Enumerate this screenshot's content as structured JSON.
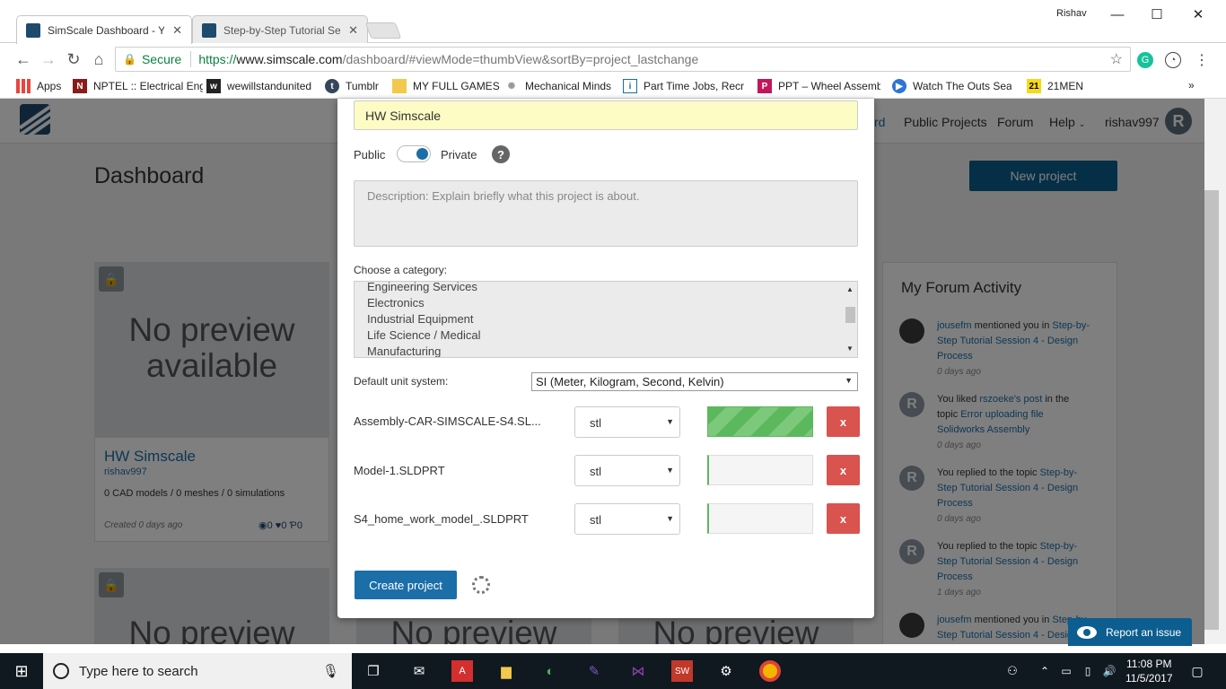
{
  "browser": {
    "tabs": [
      {
        "title": "SimScale Dashboard - Yo",
        "active": true
      },
      {
        "title": "Step-by-Step Tutorial Se",
        "active": false
      }
    ],
    "user": "Rishav",
    "url": {
      "secure_label": "Secure",
      "scheme": "https://",
      "host": "www.simscale.com",
      "path": "/dashboard/#viewMode=thumbView&sortBy=project_lastchange"
    },
    "bookmarks": [
      {
        "label": "Apps",
        "icon": "apps-grid-icon"
      },
      {
        "label": "NPTEL :: Electrical Eng",
        "icon": "nptel-icon"
      },
      {
        "label": "wewillstandunited",
        "icon": "bookmark-icon"
      },
      {
        "label": "Tumblr",
        "icon": "tumblr-icon"
      },
      {
        "label": "MY FULL GAMES",
        "icon": "folder-icon"
      },
      {
        "label": "Mechanical Minds",
        "icon": "gear-icon"
      },
      {
        "label": "Part Time Jobs, Recru",
        "icon": "jobs-icon"
      },
      {
        "label": "PPT – Wheel Assemb",
        "icon": "ppt-icon"
      },
      {
        "label": "Watch The Outs Seas",
        "icon": "play-icon"
      },
      {
        "label": "21MEN",
        "icon": "21-icon"
      }
    ]
  },
  "site": {
    "nav": {
      "partial_link": "rd",
      "public_projects": "Public Projects",
      "forum": "Forum",
      "help": "Help",
      "username": "rishav997",
      "avatar_letter": "R"
    },
    "dashboard_title": "Dashboard",
    "new_project_label": "New project",
    "project_card": {
      "preview_text_line1": "No preview",
      "preview_text_line2": "available",
      "name": "HW Simscale",
      "owner": "rishav997",
      "stats": "0 CAD models / 0 meshes / 0 simulations",
      "created": "Created 0 days ago",
      "views": "0",
      "likes": "0",
      "forks": "0"
    },
    "bottom_preview_text": "No preview",
    "forum_activity": {
      "title": "My Forum Activity",
      "items": [
        {
          "pre": "jousefm",
          "mid": " mentioned you in ",
          "link": "Step-by-Step Tutorial Session 4 - Design Process",
          "post": "",
          "time": "0 days ago",
          "avatar": "photo"
        },
        {
          "pre": "You liked ",
          "mid": "rszoeke's post",
          "link": " in the topic ",
          "post": "Error uploading file Solidworks Assembly",
          "time": "0 days ago",
          "avatar": "R"
        },
        {
          "pre": "You replied to the topic ",
          "mid": "",
          "link": "Step-by-Step Tutorial Session 4 - Design Process",
          "post": "",
          "time": "0 days ago",
          "avatar": "R"
        },
        {
          "pre": "You replied to the topic ",
          "mid": "",
          "link": "Step-by-Step Tutorial Session 4 - Design Process",
          "post": "",
          "time": "1 days ago",
          "avatar": "R"
        },
        {
          "pre": "jousefm",
          "mid": " mentioned you in ",
          "link": "Step-by-Step Tutorial Session 4 - Design Process",
          "post": "",
          "time": "",
          "avatar": "photo"
        }
      ]
    },
    "report_issue_label": "Report an issue"
  },
  "modal": {
    "project_name_value": "HW Simscale",
    "visibility": {
      "public_label": "Public",
      "private_label": "Private",
      "help_label": "?"
    },
    "description_placeholder": "Description: Explain briefly what this project is about.",
    "category_label": "Choose a category:",
    "categories": [
      "Engineering Services",
      "Electronics",
      "Industrial Equipment",
      "Life Science / Medical",
      "Manufacturing"
    ],
    "unit_label": "Default unit system:",
    "unit_value": "SI (Meter, Kilogram, Second, Kelvin)",
    "files": [
      {
        "name": "Assembly-CAR-SIMSCALE-S4.SL...",
        "format": "stl",
        "progress": 1.0
      },
      {
        "name": "Model-1.SLDPRT",
        "format": "stl",
        "progress": 0.0
      },
      {
        "name": "S4_home_work_model_.SLDPRT",
        "format": "stl",
        "progress": 0.0
      }
    ],
    "remove_label": "x",
    "create_label": "Create project"
  },
  "taskbar": {
    "search_placeholder": "Type here to search",
    "time": "11:08 PM",
    "date": "11/5/2017"
  }
}
